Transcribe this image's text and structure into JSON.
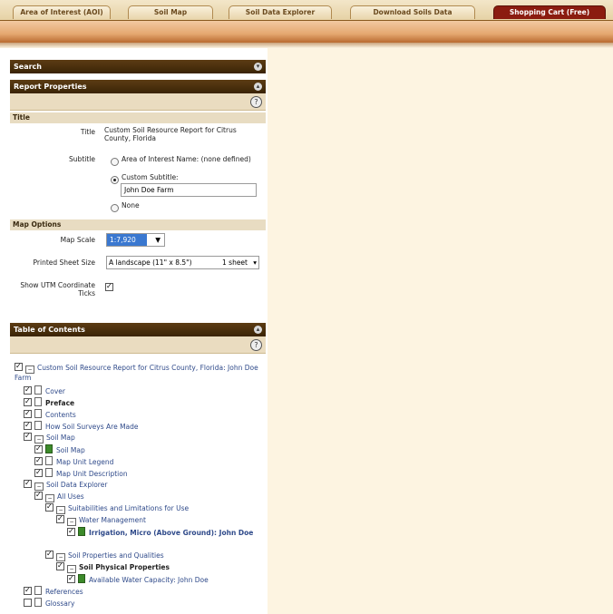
{
  "tabs": [
    {
      "label": "Area of Interest (AOI)",
      "active": false
    },
    {
      "label": "Soil Map",
      "active": false
    },
    {
      "label": "Soil Data Explorer",
      "active": false
    },
    {
      "label": "Download Soils Data",
      "active": false
    },
    {
      "label": "Shopping Cart (Free)",
      "active": true
    }
  ],
  "search_panel": {
    "title": "Search"
  },
  "report_panel": {
    "title": "Report Properties",
    "title_section": "Title",
    "title_label": "Title",
    "title_value": "Custom Soil Resource Report for Citrus County, Florida",
    "subtitle_label": "Subtitle",
    "subtitle_options": [
      "Area of Interest Name: (none defined)",
      "Custom Subtitle:",
      "None"
    ],
    "custom_subtitle_value": "John Doe Farm",
    "map_options_section": "Map Options",
    "map_scale_label": "Map Scale",
    "map_scale_value": "1:7,920",
    "sheet_size_label": "Printed Sheet Size",
    "sheet_size_value": "A landscape (11\" x 8.5\")",
    "sheet_size_value2": "1 sheet",
    "utm_label": "Show UTM Coordinate Ticks"
  },
  "toc_panel": {
    "title": "Table of Contents",
    "items": [
      {
        "label": "Custom Soil Resource Report for Citrus County, Florida: John Doe Farm"
      },
      {
        "label": "Cover"
      },
      {
        "label": "Preface"
      },
      {
        "label": "Contents"
      },
      {
        "label": "How Soil Surveys Are Made"
      },
      {
        "label": "Soil Map"
      },
      {
        "label": "Soil Map"
      },
      {
        "label": "Map Unit Legend"
      },
      {
        "label": "Map Unit Description"
      },
      {
        "label": "Soil Data Explorer"
      },
      {
        "label": "All Uses"
      },
      {
        "label": "Suitabilities and Limitations for Use"
      },
      {
        "label": "Water Management"
      },
      {
        "label": "Irrigation, Micro (Above Ground): John Doe"
      },
      {
        "label": "Soil Properties and Qualities"
      },
      {
        "label": "Soil Physical Properties"
      },
      {
        "label": "Available Water Capacity: John Doe"
      },
      {
        "label": "References"
      },
      {
        "label": "Glossary"
      }
    ]
  },
  "icons": {
    "collapse": "collapse-icon",
    "help": "help-icon"
  }
}
